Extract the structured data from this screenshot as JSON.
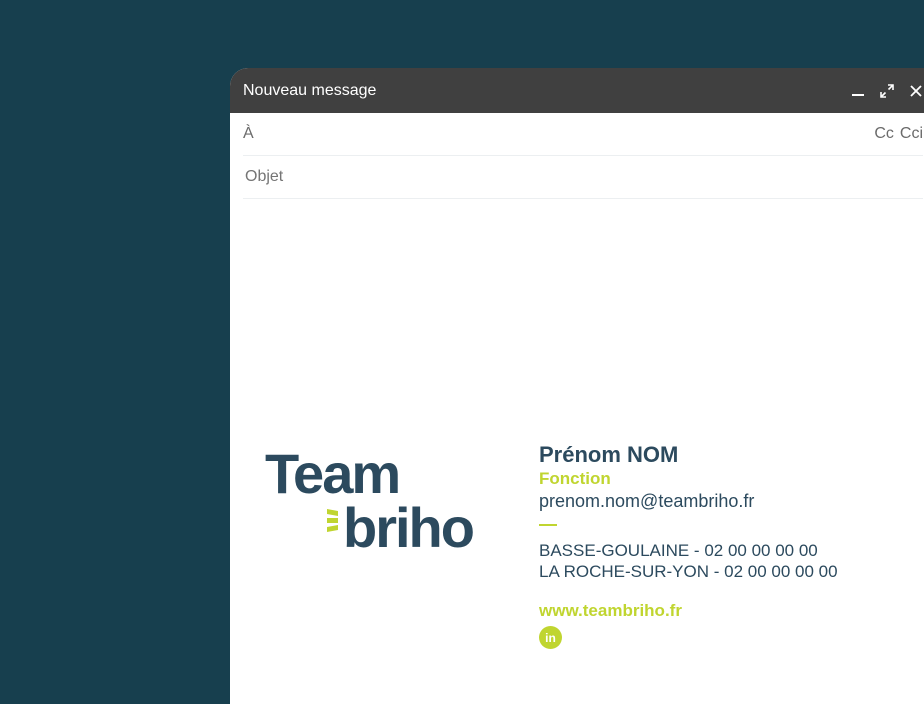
{
  "compose": {
    "title": "Nouveau message",
    "to_label": "À",
    "cc_label": "Cc",
    "bcc_label": "Cci",
    "subject_placeholder": "Objet"
  },
  "icons": {
    "minimize": "minimize-icon",
    "expand": "expand-icon",
    "close": "close-icon",
    "linkedin": "linkedin-icon"
  },
  "logo": {
    "line1": "Team",
    "line2": "briho"
  },
  "signature": {
    "name": "Prénom NOM",
    "role": "Fonction",
    "email": "prenom.nom@teambriho.fr",
    "office_1": "BASSE-GOULAINE - 02 00 00 00 00",
    "office_2": "LA ROCHE-SUR-YON - 02 00 00 00 00",
    "website": "www.teambriho.fr",
    "linkedin_glyph": "in"
  },
  "colors": {
    "background": "#173f4e",
    "titlebar": "#404040",
    "brand_dark": "#2c4a5e",
    "brand_accent": "#c0d530"
  }
}
